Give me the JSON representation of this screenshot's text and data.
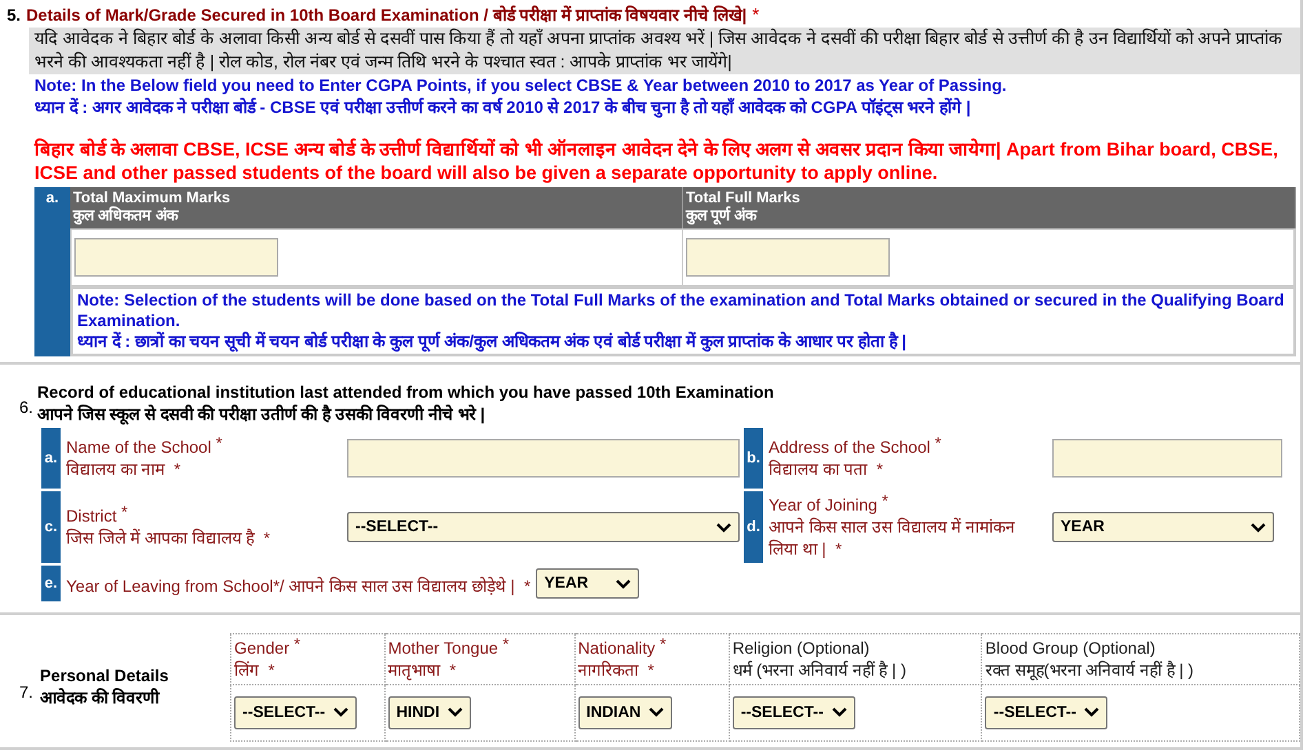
{
  "section5": {
    "number": "5.",
    "title": "Details of Mark/Grade Secured in 10th Board Examination / बोर्ड परीक्षा में प्राप्तांक विषयवार नीचे लिखे|",
    "mark": "*",
    "instruction": "यदि आवेदक ने बिहार बोर्ड के अलावा किसी अन्य बोर्ड से दसवीं पास किया हैं तो यहाँ अपना प्राप्तांक अवश्य भरें | जिस आवेदक ने दसवीं की परीक्षा बिहार बोर्ड से उत्तीर्ण की है उन विद्यार्थियों को अपने प्राप्तांक भरने की आवश्यकता नहीं है | रोल कोड, रोल नंबर एवं जन्म तिथि भरने के पश्चात स्वत : आपके प्राप्तांक भर जायेंगे|",
    "note_en": "Note: In the Below field you need to Enter CGPA Points, if you select CBSE & Year between 2010 to 2017 as Year of Passing.",
    "note_hi": "ध्यान दें : अगर आवेदक ने परीक्षा बोर्ड - CBSE एवं परीक्षा उत्तीर्ण करने का वर्ष 2010 से 2017 के बीच चुना है तो यहाँ आवेदक को CGPA पॉइंट्स भरने होंगे |",
    "notice": "बिहार बोर्ड के अलावा CBSE, ICSE अन्य बोर्ड के उत्तीर्ण विद्यार्थियों को भी ऑनलाइन आवेदन देने के लिए अलग से अवसर प्रदान किया जायेगा| Apart from Bihar board, CBSE, ICSE and other passed students of the board will also be given a separate opportunity to apply online.",
    "marks": {
      "letter": "a.",
      "columns": [
        {
          "label_en": "Total Maximum Marks",
          "label_hi": "कुल अधिकतम अंक"
        },
        {
          "label_en": "Total Full Marks",
          "label_hi": "कुल पूर्ण अंक"
        }
      ],
      "note_en": "Note: Selection of the students will be done based on the Total Full Marks of the examination and Total Marks obtained or secured in the Qualifying Board Examination.",
      "note_hi": "ध्यान दें : छात्रों का चयन सूची में चयन बोर्ड परीक्षा के कुल पूर्ण अंक/कुल अधिकतम अंक एवं बोर्ड परीक्षा में कुल प्राप्तांक के आधार पर होता है |"
    }
  },
  "section6": {
    "number": "6.",
    "title_en": "Record of educational institution last attended from which you have passed 10th Examination",
    "title_hi": "आपने जिस स्कूल से दसवी की परीक्षा उतीर्ण की है उसकी विवरणी नीचे भरे |",
    "rows": [
      [
        {
          "letter": "a.",
          "label_en": "Name of the School",
          "mark_en": "*",
          "label_hi": "विद्यालय का नाम",
          "mark_hi": "*",
          "kind": "input"
        },
        {
          "letter": "b.",
          "label_en": "Address of the School",
          "mark_en": "*",
          "label_hi": "विद्यालय का पता",
          "mark_hi": "*",
          "kind": "input"
        }
      ],
      [
        {
          "letter": "c.",
          "label_en": "District",
          "mark_en": "*",
          "label_hi": "जिस जिले में आपका विद्यालय है",
          "mark_hi": "*",
          "kind": "select",
          "value": "--SELECT--"
        },
        {
          "letter": "d.",
          "label_en": "Year of Joining",
          "mark_en": "*",
          "label_hi": "आपने किस साल उस विद्यालय में नामांकन लिया था |",
          "mark_hi": "*",
          "kind": "select",
          "value": "YEAR"
        }
      ]
    ],
    "leaving": {
      "letter": "e.",
      "label_en": "Year of Leaving from School",
      "mark_en": "*",
      "label_hi": "/ आपने किस साल उस विद्यालय छोड़ेथे |",
      "mark_hi": "*",
      "value": "YEAR"
    }
  },
  "section7": {
    "number": "7.",
    "title_en": "Personal Details",
    "title_hi": "आवेदक की विवरणी",
    "columns": [
      {
        "label_en": "Gender",
        "mark_en": "*",
        "label_hi": "लिंग",
        "mark_hi": "*",
        "kind": "required",
        "value": "--SELECT--"
      },
      {
        "label_en": "Mother Tongue",
        "mark_en": "*",
        "label_hi": "मातृभाषा",
        "mark_hi": "*",
        "kind": "required",
        "value": "HINDI"
      },
      {
        "label_en": "Nationality",
        "mark_en": "*",
        "label_hi": "नागरिकता",
        "mark_hi": "*",
        "kind": "required",
        "value": "INDIAN"
      },
      {
        "label_en": "Religion (Optional)",
        "label_hi": "धर्म (भरना अनिवार्य नहीं है | )",
        "kind": "optional",
        "value": "--SELECT--"
      },
      {
        "label_en": "Blood Group (Optional)",
        "label_hi": "रक्त समूह(भरना अनिवार्य नहीं है | )",
        "kind": "optional",
        "value": "--SELECT--"
      }
    ]
  }
}
